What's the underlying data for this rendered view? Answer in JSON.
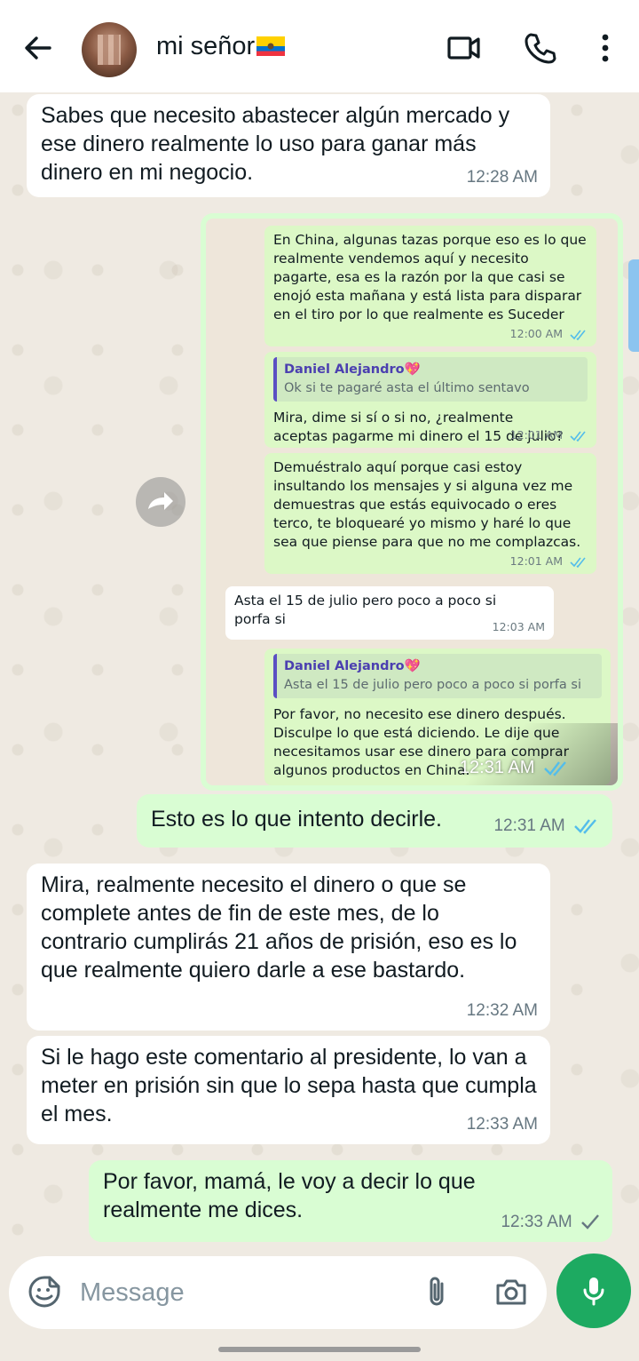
{
  "header": {
    "contact_name": "mi señor",
    "flag": "ecuador-flag"
  },
  "colors": {
    "header_bg": "#ffffff",
    "chat_bg": "#efeae2",
    "incoming_bubble": "#ffffff",
    "outgoing_bubble": "#d9fdd3",
    "read_tick": "#53bdeb",
    "mic_button": "#1daa61"
  },
  "messages": [
    {
      "direction": "in",
      "text": "Sabes que necesito abastecer algún mercado y ese dinero realmente lo uso para ganar más dinero en mi negocio.",
      "time": "12:28 AM"
    },
    {
      "direction": "out",
      "text": "Esto es lo que intento decirle.",
      "time": "12:31 AM",
      "status": "read"
    },
    {
      "direction": "in",
      "text": "Mira, realmente necesito el dinero o que se complete antes de fin de este mes, de lo contrario cumplirás 21 años de prisión, eso es lo que realmente quiero darle a ese bastardo.",
      "time": "12:32 AM"
    },
    {
      "direction": "in",
      "text": "Si le hago este comentario al presidente, lo van a meter en prisión sin que lo sepa hasta que cumpla el mes.",
      "time": "12:33 AM"
    },
    {
      "direction": "out",
      "text": "Por favor, mamá, le voy a decir lo que realmente me dices.",
      "time": "12:33 AM",
      "status": "sent"
    }
  ],
  "image_message": {
    "time": "12:31 AM",
    "status": "read",
    "screenshot": {
      "m1": {
        "text": "En China, algunas tazas porque eso es lo que realmente vendemos aquí y necesito pagarte, esa es la razón por la que casi se enojó esta mañana y está lista para disparar en el tiro por lo que realmente es Suceder",
        "time": "12:00 AM"
      },
      "m2": {
        "quote_name": "Daniel Alejandro💖",
        "quote_text": "Ok si te pagaré asta el último sentavo",
        "text": "Mira, dime si sí o si no, ¿realmente aceptas pagarme mi dinero el 15 de julio?",
        "time": "12:01 AM"
      },
      "m3": {
        "text": "Demuéstralo aquí porque casi estoy insultando los mensajes y si alguna vez me demuestras que estás equivocado o eres terco, te bloquearé yo mismo y haré lo que sea que piense para que no me complazcas.",
        "time": "12:01 AM"
      },
      "m4": {
        "text": "Asta el 15 de julio pero poco a poco si porfa si",
        "time": "12:03 AM"
      },
      "m5": {
        "quote_name": "Daniel Alejandro💖",
        "quote_text": "Asta el 15 de julio pero poco a poco si porfa si",
        "text": "Por favor, no necesito ese dinero después. Disculpe lo que está diciendo. Le dije que necesitamos usar ese dinero para comprar algunos productos en China."
      }
    }
  },
  "input": {
    "placeholder": "Message"
  }
}
